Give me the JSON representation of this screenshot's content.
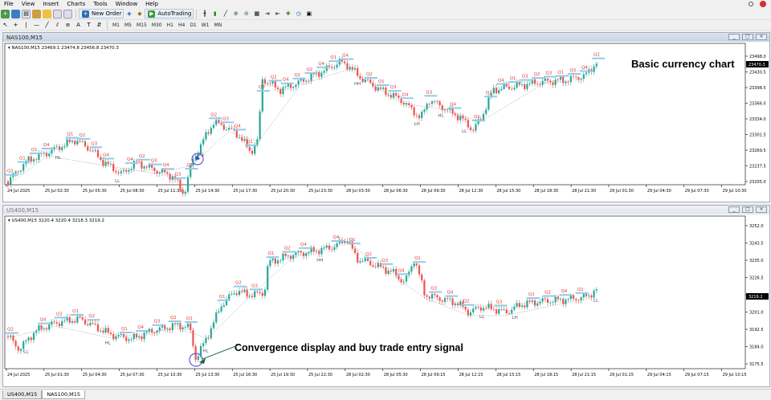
{
  "menu": [
    "File",
    "View",
    "Insert",
    "Charts",
    "Tools",
    "Window",
    "Help"
  ],
  "toolbar": {
    "new_order": "New Order",
    "autotrading": "AutoTrading",
    "timeframes": [
      "M1",
      "M5",
      "M15",
      "M30",
      "H1",
      "H4",
      "D1",
      "W1",
      "MN"
    ]
  },
  "colors": {
    "bull": "#27a69a",
    "bear": "#ef5350",
    "label_red": "#e53935",
    "level_blue": "#8ecde8",
    "annotation_circle": "#6a5acd"
  },
  "charts": [
    {
      "window_title": "NAS100,M15",
      "info": "NAS100,M15  23469.1 23474.8 23456.8 23470.3",
      "annotation": "Basic currency chart",
      "current_price": "23470.3",
      "price_ticks": [
        "23498.0",
        "23430.5",
        "23398.5",
        "23366.0",
        "23334.0",
        "23301.5",
        "23269.5",
        "23237.5",
        "23205.0"
      ],
      "time_ticks": [
        "24 Jul 2025",
        "25 Jul 02:30",
        "25 Jul 05:30",
        "25 Jul 08:30",
        "25 Jul 11:30",
        "25 Jul 14:30",
        "25 Jul 17:30",
        "25 Jul 20:30",
        "25 Jul 23:30",
        "28 Jul 03:30",
        "28 Jul 06:30",
        "28 Jul 09:30",
        "28 Jul 12:30",
        "28 Jul 15:30",
        "28 Jul 18:30",
        "28 Jul 21:30",
        "29 Jul 01:30",
        "29 Jul 04:30",
        "29 Jul 07:30",
        "29 Jul 10:30"
      ],
      "labels": [
        "Q2",
        "Q1",
        "Q1",
        "Q4",
        "HL",
        "Q1",
        "Q2",
        "Q3",
        "Q4",
        "LL",
        "Q4",
        "Q2",
        "Q3",
        "Q4",
        "Q3",
        "Q1",
        "HL",
        "Q2",
        "Q3",
        "Q4",
        "Q1",
        "Q3",
        "Q2",
        "Q4",
        "Q1",
        "Q2",
        "Q4",
        "Q1",
        "Q4",
        "HH",
        "Q2",
        "Q1",
        "Q3",
        "Q4",
        "LH",
        "Q3",
        "HL",
        "Q4",
        "LL",
        "Q1",
        "Q2",
        "Q4",
        "Q1",
        "Q3",
        "Q2",
        "Q3",
        "Q1",
        "Q3",
        "Q4",
        "Q2"
      ]
    },
    {
      "window_title": "US400,M15",
      "info": "US400,M15  3220.4 3220.4 3218.3 3219.2",
      "annotation": "Convergence display and buy trade entry signal",
      "current_price": "3219.2",
      "price_ticks": [
        "3252.0",
        "3243.5",
        "3235.0",
        "3226.5",
        "3209.5",
        "3201.0",
        "3192.5",
        "3184.0",
        "3175.5"
      ],
      "time_ticks": [
        "24 Jul 2025",
        "25 Jul 01:30",
        "25 Jul 04:30",
        "25 Jul 07:30",
        "25 Jul 10:30",
        "25 Jul 13:30",
        "25 Jul 16:30",
        "25 Jul 19:30",
        "25 Jul 22:30",
        "28 Jul 02:30",
        "28 Jul 05:30",
        "28 Jul 09:15",
        "28 Jul 12:15",
        "28 Jul 15:15",
        "28 Jul 18:15",
        "28 Jul 21:15",
        "29 Jul 01:15",
        "29 Jul 04:15",
        "29 Jul 07:15",
        "29 Jul 10:15"
      ],
      "labels": [
        "Q2",
        "LL",
        "Q4",
        "Q3",
        "Q1",
        "Q2",
        "HL",
        "Q1",
        "Q4",
        "Q3",
        "Q2",
        "Q1",
        "HL",
        "Q1",
        "Q2",
        "Q3",
        "Q1",
        "Q2",
        "Q4",
        "HH",
        "Q4",
        "Q1",
        "Q2",
        "Q3",
        "Q4",
        "Q1",
        "Q3",
        "Q4",
        "Q2",
        "LL",
        "Q3",
        "LH",
        "Q1",
        "Q2",
        "Q4",
        "Q2",
        "LL"
      ]
    }
  ],
  "tabs": [
    "US400,M15",
    "NAS100,M15"
  ]
}
